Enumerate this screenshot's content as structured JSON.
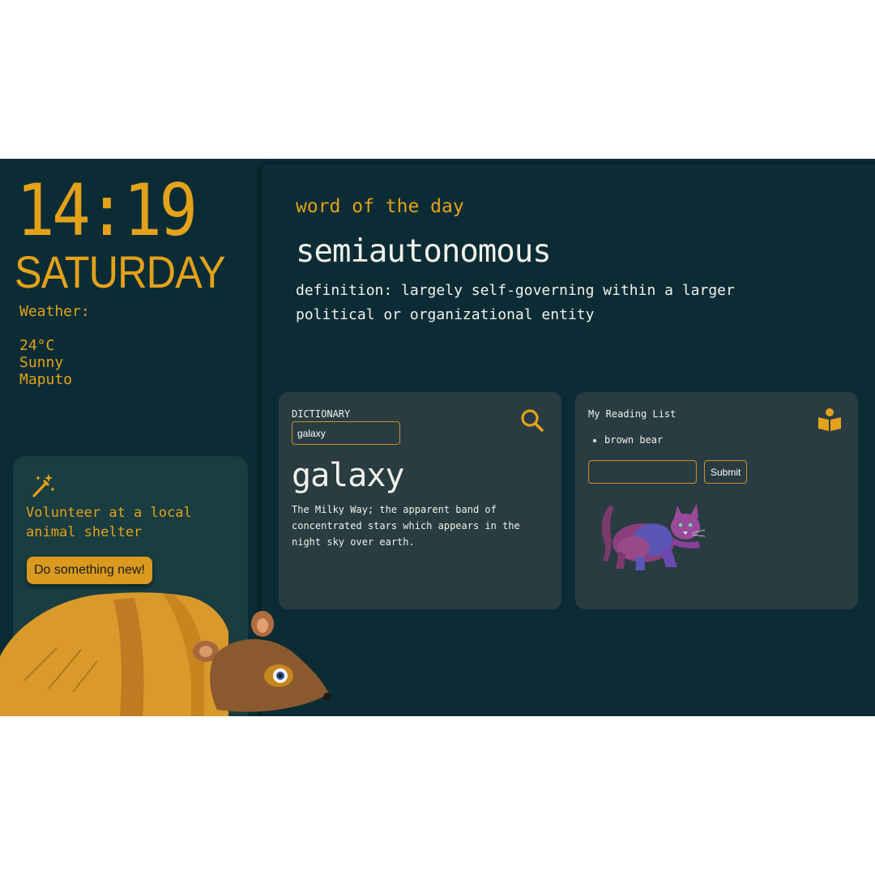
{
  "clock": {
    "time": "14:19",
    "day": "SATURDAY"
  },
  "weather": {
    "title": "Weather:",
    "temperature": "24°C",
    "condition": "Sunny",
    "city": "Maputo"
  },
  "suggestion": {
    "icon": "magic-wand-icon",
    "text": "Volunteer at a local animal shelter",
    "button_label": "Do something new!"
  },
  "word_of_the_day": {
    "label": "word of the day",
    "word": "semiautonomous",
    "definition": "definition: largely self-governing within a larger political or organizational entity"
  },
  "dictionary": {
    "label": "DICTIONARY",
    "input_value": "galaxy",
    "search_icon": "search-icon",
    "word": "galaxy",
    "definition": "The Milky Way; the apparent band of concentrated stars which appears in the night sky over earth."
  },
  "reading_list": {
    "title": "My Reading List",
    "icon": "open-book-reader-icon",
    "items": [
      "brown bear"
    ],
    "input_value": "",
    "submit_label": "Submit"
  },
  "colors": {
    "background": "#0c2c35",
    "accent": "#e3a21a",
    "card": "#283c41",
    "suggest_card": "#193d40",
    "text": "#f1f1ea"
  }
}
